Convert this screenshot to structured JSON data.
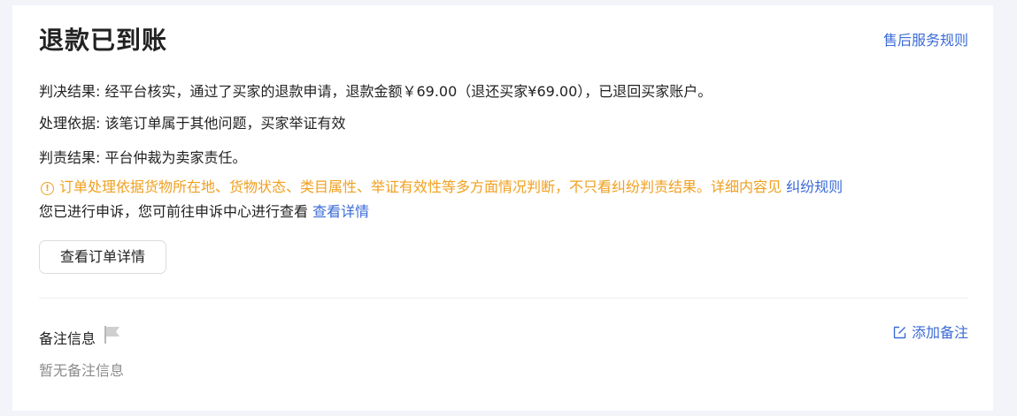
{
  "header": {
    "title": "退款已到账",
    "rules_link": "售后服务规则"
  },
  "details": {
    "judgment_label": "判决结果: ",
    "judgment_value": "经平台核实，通过了买家的退款申请，退款金额￥69.00（退还买家¥69.00），已退回买家账户。",
    "basis_label": "处理依据: ",
    "basis_value": "该笔订单属于其他问题，买家举证有效",
    "responsibility_label": "判责结果: ",
    "responsibility_value": "平台仲裁为卖家责任。"
  },
  "warning": {
    "icon": "info-circle-icon",
    "text": "订单处理依据货物所在地、货物状态、类目属性、举证有效性等多方面情况判断，不只看纠纷判责结果。详细内容见",
    "link": "纠纷规则",
    "color": "#f0a020"
  },
  "appeal": {
    "text": "您已进行申诉，您可前往申诉中心进行查看",
    "link": "查看详情"
  },
  "actions": {
    "view_order": "查看订单详情"
  },
  "notes": {
    "title": "备注信息",
    "flag_icon": "flag-icon",
    "add_label": "添加备注",
    "add_icon": "edit-icon",
    "empty_text": "暂无备注信息"
  },
  "colors": {
    "link": "#3b6bd6",
    "background": "#f2f4fa"
  }
}
